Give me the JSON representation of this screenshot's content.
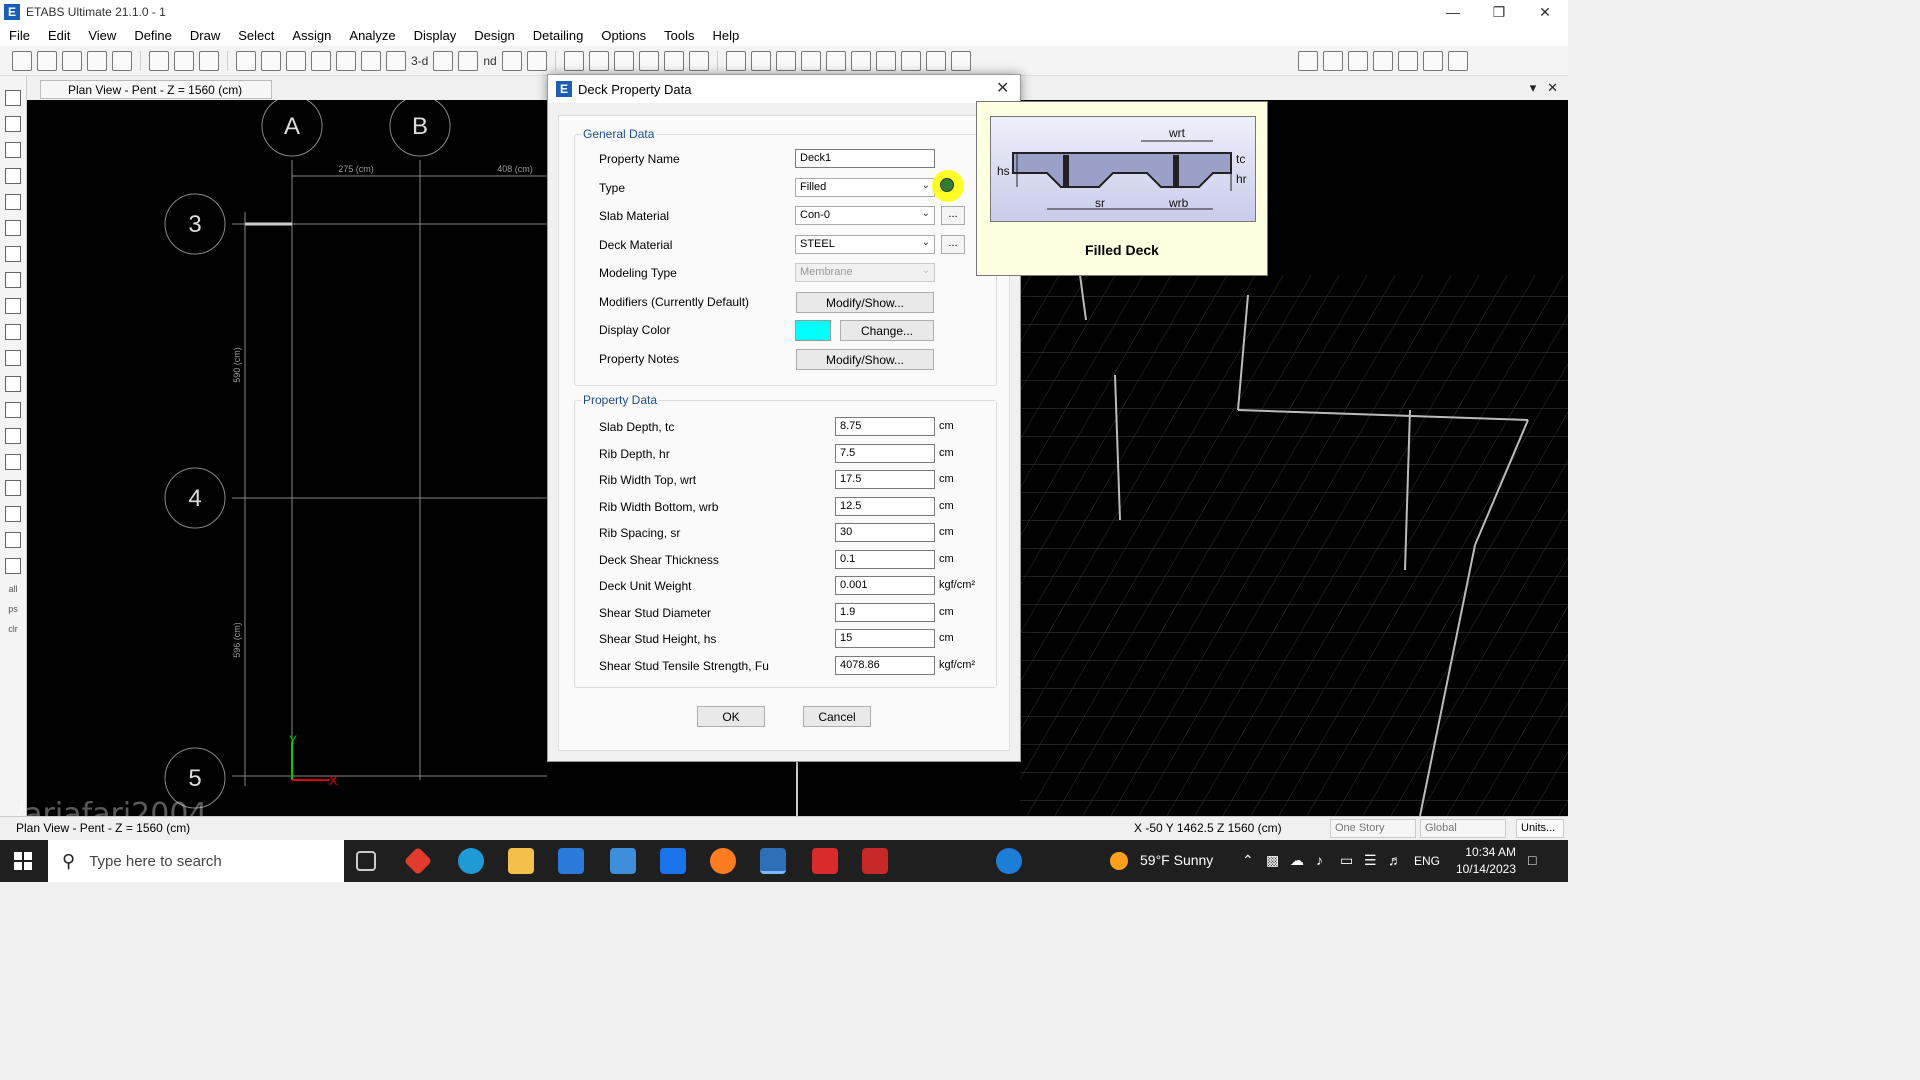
{
  "window": {
    "title": "ETABS Ultimate 21.1.0 - 1",
    "controls": [
      "minimize",
      "restore",
      "close"
    ]
  },
  "menu": [
    "File",
    "Edit",
    "View",
    "Define",
    "Draw",
    "Select",
    "Assign",
    "Analyze",
    "Display",
    "Design",
    "Detailing",
    "Options",
    "Tools",
    "Help"
  ],
  "toolbar": {
    "view3d_label": "3-d",
    "nd_label": "nd"
  },
  "view_tab": {
    "title": "Plan View - Pent - Z = 1560 (cm)"
  },
  "plan": {
    "grid_bubbles": [
      "A",
      "B",
      "3",
      "4",
      "5"
    ],
    "dims_h": [
      "275 (cm)",
      "408 (cm)"
    ],
    "dims_v": [
      "590 (cm)",
      "596 (cm)"
    ],
    "axis_labels": [
      "Y",
      "X"
    ]
  },
  "left_toolbar": {
    "all_label": "all",
    "ps_label": "ps",
    "clr_label": "clr"
  },
  "watermark": "/ariafari2004",
  "dialog": {
    "title": "Deck Property Data",
    "general": {
      "group_title": "General Data",
      "property_name_label": "Property Name",
      "property_name_value": "Deck1",
      "type_label": "Type",
      "type_value": "Filled",
      "slab_material_label": "Slab Material",
      "slab_material_value": "Con-0",
      "deck_material_label": "Deck Material",
      "deck_material_value": "STEEL",
      "modeling_type_label": "Modeling Type",
      "modeling_type_value": "Membrane",
      "modifiers_label": "Modifiers (Currently Default)",
      "modifiers_button": "Modify/Show...",
      "display_color_label": "Display Color",
      "display_color_value": "#00ffff",
      "change_button": "Change...",
      "notes_label": "Property Notes",
      "notes_button": "Modify/Show...",
      "dots": "..."
    },
    "property": {
      "group_title": "Property Data",
      "rows": [
        {
          "label": "Slab Depth, tc",
          "value": "8.75",
          "unit": "cm"
        },
        {
          "label": "Rib Depth, hr",
          "value": "7.5",
          "unit": "cm"
        },
        {
          "label": "Rib Width Top, wrt",
          "value": "17.5",
          "unit": "cm"
        },
        {
          "label": "Rib Width Bottom, wrb",
          "value": "12.5",
          "unit": "cm"
        },
        {
          "label": "Rib Spacing, sr",
          "value": "30",
          "unit": "cm"
        },
        {
          "label": "Deck Shear Thickness",
          "value": "0.1",
          "unit": "cm"
        },
        {
          "label": "Deck Unit Weight",
          "value": "0.001",
          "unit": "kgf/cm²"
        },
        {
          "label": "Shear Stud Diameter",
          "value": "1.9",
          "unit": "cm"
        },
        {
          "label": "Shear Stud Height, hs",
          "value": "15",
          "unit": "cm"
        },
        {
          "label": "Shear Stud Tensile Strength, Fu",
          "value": "4078.86",
          "unit": "kgf/cm²"
        }
      ]
    },
    "ok_button": "OK",
    "cancel_button": "Cancel"
  },
  "info_popup": {
    "caption": "Filled Deck",
    "diagram_labels": {
      "wrt": "wrt",
      "tc": "tc",
      "hr": "hr",
      "hs": "hs",
      "sr": "sr",
      "wrb": "wrb"
    }
  },
  "statusbar": {
    "view_text": "Plan View - Pent - Z = 1560 (cm)",
    "coords": "X -50  Y 1462.5  Z 1560 (cm)",
    "story_select": "One Story",
    "coord_select": "Global",
    "units_button": "Units..."
  },
  "taskbar": {
    "search_placeholder": "Type here to search",
    "weather": "59°F  Sunny",
    "lang": "ENG",
    "time": "10:34 AM",
    "date": "10/14/2023"
  }
}
